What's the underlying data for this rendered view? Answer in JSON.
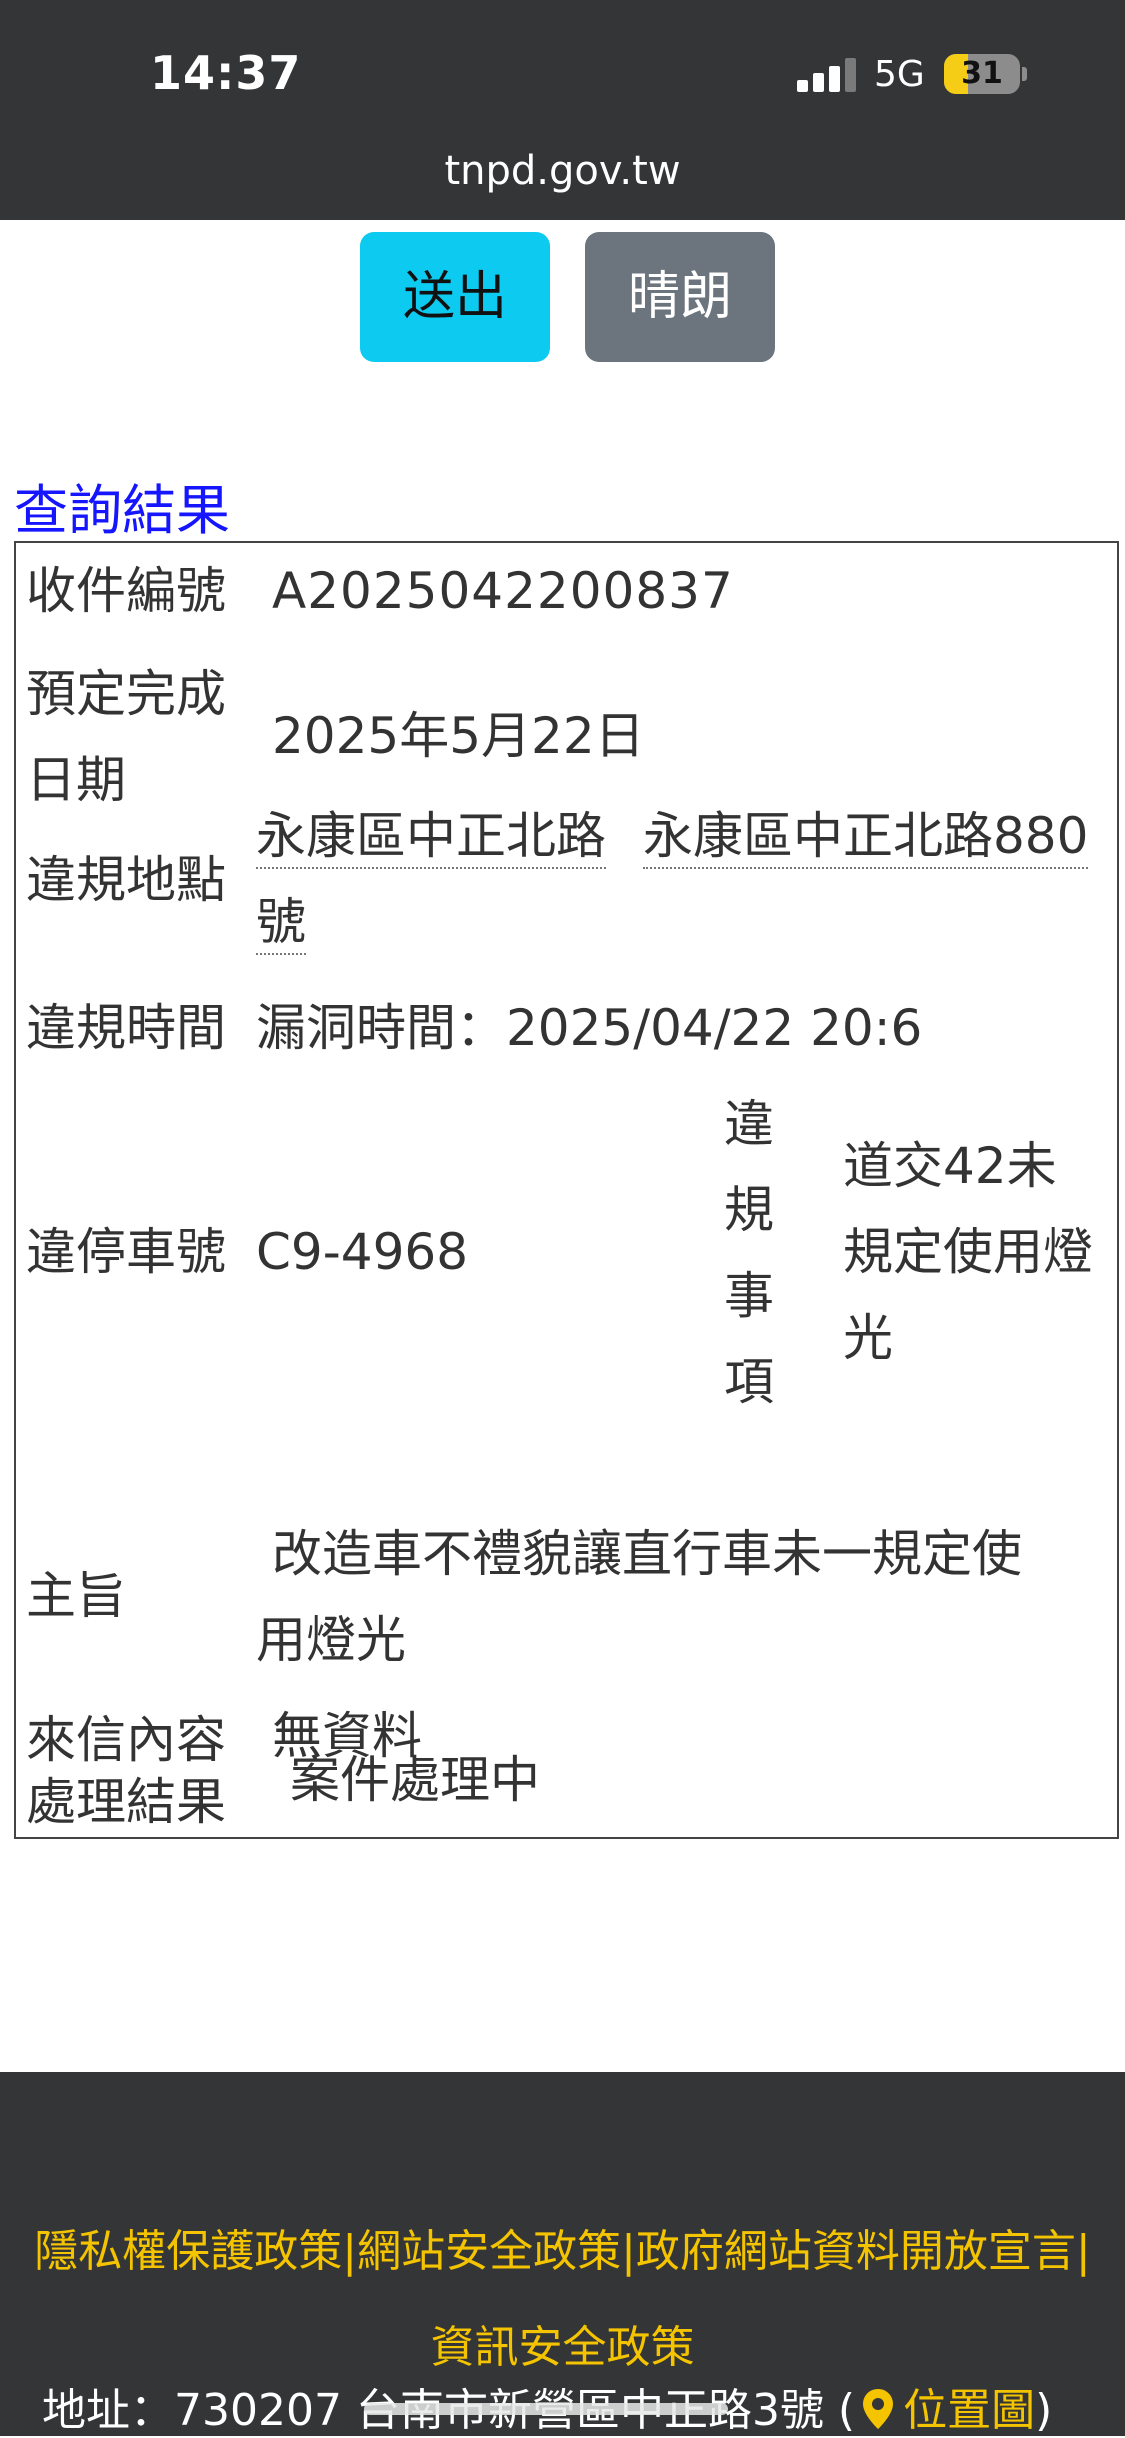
{
  "status_bar": {
    "time": "14:37",
    "network": "5G",
    "battery": "31",
    "battery_level": 0.31
  },
  "browser": {
    "url": "tnpd.gov.tw"
  },
  "buttons": {
    "submit": "送出",
    "clear": "晴朗"
  },
  "result": {
    "title": "查詢結果",
    "rows": {
      "case_no_label": "收件編號",
      "case_no_value": "A2025042200837",
      "due_label_1": "預定完成",
      "due_label_2": "日期",
      "due_value": "2025年5月22日",
      "location_label": "違規地點",
      "location_part1": "永康區中正北路",
      "location_part2": "永康區中正北路880",
      "location_part3": "號",
      "time_label": "違規時間",
      "time_value": "漏洞時間：2025/04/22 20:6",
      "plate_label": "違停車號",
      "plate_value": "C9-4968",
      "item_label_chars": [
        "違",
        "規",
        "事",
        "項"
      ],
      "item_value_lines": [
        "道交42未",
        "規定使用燈",
        "光"
      ],
      "subject_label": "主旨",
      "subject_line1": "改造車不禮貌讓直行車未一規定使",
      "subject_line2": "用燈光",
      "content_label": "來信內容",
      "content_value": "無資料",
      "outcome_label": "處理結果",
      "outcome_value": "案件處理中"
    }
  },
  "footer": {
    "policy_privacy": "隱私權保護政策",
    "policy_web_security": "網站安全政策",
    "policy_open_data": "政府網站資料開放宣言",
    "policy_info_security": "資訊安全政策",
    "separator": "|",
    "address_prefix": "地址：730207 台南市新營區中正路3號 (",
    "map_link": "位置圖",
    "address_suffix": ")"
  },
  "colors": {
    "chrome_bg": "#333537",
    "submit_bg": "#0dcaf0",
    "clear_bg": "#6c757d",
    "title_blue": "#1515ff",
    "footer_link": "#f5c400"
  }
}
